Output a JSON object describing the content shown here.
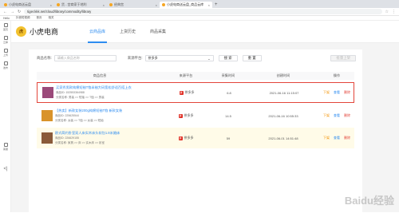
{
  "browser": {
    "tabs": [
      {
        "label": "小虎电商送云盘"
      },
      {
        "label": "货 - 宫商家于地利"
      },
      {
        "label": "经典宫"
      },
      {
        "label": "小虎电商送云盘_商品云库"
      }
    ],
    "url": "tiger.kkk.net/cloud/library/commodity/library",
    "bookmarks": [
      "Hello",
      "抖音短视频",
      "首页",
      "相关"
    ]
  },
  "sidebar": [
    {
      "label": "首页"
    },
    {
      "label": "云库"
    },
    {
      "label": "上传"
    },
    {
      "label": "发布"
    },
    {
      "label": "客服"
    }
  ],
  "header": {
    "logo": "虎",
    "brand": "小虎电商",
    "tabs": [
      "云商品库",
      "上货历史",
      "商品采集"
    ]
  },
  "filters": {
    "name_label": "商品名称:",
    "name_placeholder": "请输入商品名称",
    "platform_label": "来源平台:",
    "platform_value": "拼多多",
    "search": "搜 索",
    "reset": "重 置",
    "batch": "批量上架"
  },
  "table": {
    "headers": [
      "商品信息",
      "来源平台",
      "采集时间",
      "创建时间",
      "操作"
    ],
    "rows": [
      {
        "title": "买家秀男款纯棉短袖T恤半袖大码宽松舒适百搭上衣",
        "meta": "商品ID: 152553364988",
        "sub": "分类名称: 男装 >> 短袖 >> T恤 >> 男装",
        "platform": "拼多多",
        "num": "6.8",
        "time": "2021-06-16 11:15:07",
        "thumb": "#9b4a7a",
        "ops": [
          "下架",
          "查看",
          "删除"
        ]
      },
      {
        "title": "【热卖】新款女装200g纯棉短袖T恤 新款女装",
        "meta": "商品ID: 225625544",
        "sub": "分类名称: 女装 >> T恤 >> 女装 >> 短袖",
        "platform": "拼多多",
        "num": "14.5",
        "time": "2021-06-16 10:55:33",
        "thumb": "#d9932a",
        "ops": [
          "下架",
          "查看",
          "删除"
        ]
      },
      {
        "title": "欧式简约卧室双人床实木床头软包1.8米婚床",
        "meta": "商品ID: 226629155",
        "sub": "分类名称: 家具 >> 床 >> 实木床 >> 卧室",
        "platform": "拼多多",
        "num": "59",
        "time": "2021-06-01 14:51:48",
        "thumb": "#8a5a3a",
        "ops": [
          "下架",
          "查看",
          "删除"
        ]
      }
    ]
  },
  "watermark": "Baidu经验"
}
